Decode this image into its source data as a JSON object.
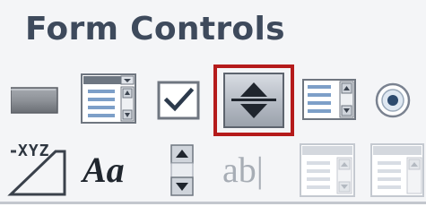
{
  "panel": {
    "title": "Form Controls"
  },
  "controls_row1": [
    {
      "name": "button",
      "icon": "button-icon"
    },
    {
      "name": "combo-box",
      "icon": "combo-box-icon"
    },
    {
      "name": "check-box",
      "icon": "checkbox-icon"
    },
    {
      "name": "spin-button",
      "icon": "spin-button-icon",
      "selected": true
    },
    {
      "name": "list-box",
      "icon": "list-box-icon"
    },
    {
      "name": "option-button",
      "icon": "option-button-icon"
    }
  ],
  "controls_row2": [
    {
      "name": "group-box",
      "icon": "group-box-icon",
      "label": "XYZ"
    },
    {
      "name": "label",
      "icon": "label-icon",
      "label": "Aa"
    },
    {
      "name": "scroll-bar",
      "icon": "scroll-bar-icon"
    },
    {
      "name": "text-field",
      "icon": "text-field-icon",
      "label": "ab|"
    },
    {
      "name": "combo-list-edit",
      "icon": "combo-list-edit-icon"
    },
    {
      "name": "combo-drop-down-edit",
      "icon": "combo-drop-down-edit-icon"
    }
  ],
  "colors": {
    "highlight": "#b51b1b",
    "title": "#3e4a5c",
    "panel_bg": "#f4f5f7"
  }
}
